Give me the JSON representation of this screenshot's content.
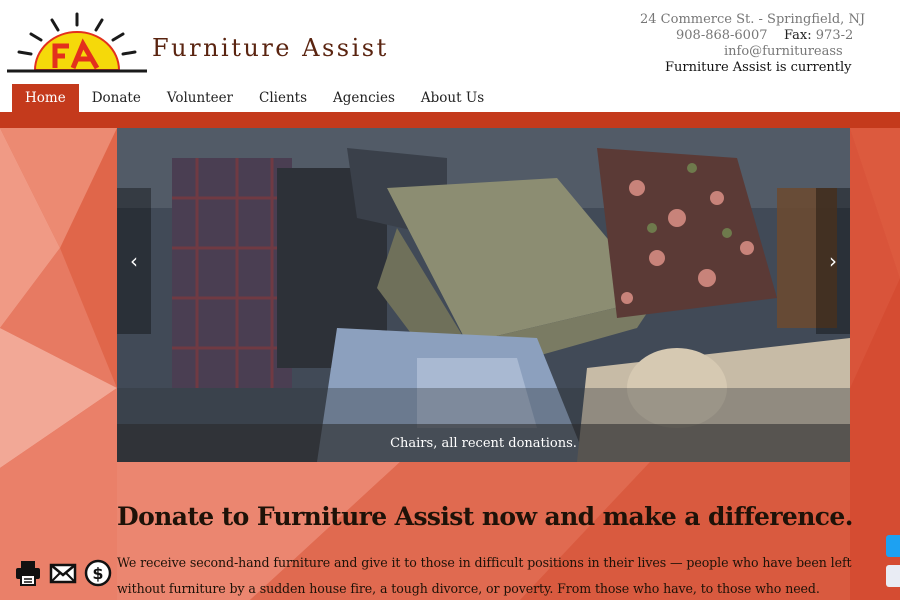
{
  "site": {
    "title": "Furniture Assist",
    "logo_letters": "FA"
  },
  "contact": {
    "address": "24 Commerce St. - Springfield, NJ",
    "phone": "908-868-6007",
    "fax_label": "Fax:",
    "fax": "973-2",
    "email": "info@furnitureass",
    "status": "Furniture Assist is currently"
  },
  "nav": {
    "items": [
      {
        "label": "Home",
        "active": true
      },
      {
        "label": "Donate",
        "active": false
      },
      {
        "label": "Volunteer",
        "active": false
      },
      {
        "label": "Clients",
        "active": false
      },
      {
        "label": "Agencies",
        "active": false
      },
      {
        "label": "About Us",
        "active": false
      }
    ]
  },
  "slider": {
    "prev_label": "‹",
    "next_label": "›",
    "caption": "Chairs, all recent donations."
  },
  "main": {
    "headline": "Donate to Furniture Assist now and make a difference.",
    "body": "We receive second-hand furniture and give it to those in difficult positions in their lives — people who have been left without furniture by a sudden house fire, a tough divorce, or poverty. From those who have, to those who need."
  },
  "share": {
    "icons": [
      "print-icon",
      "email-icon",
      "donate-dollar-icon"
    ]
  },
  "social": {
    "icons": [
      "twitter-icon",
      "facebook-like-icon"
    ]
  },
  "colors": {
    "brand_red": "#c43a1c",
    "background_orange": "#e0664a",
    "sun_yellow": "#f5d90a",
    "sun_red": "#e3301d"
  }
}
